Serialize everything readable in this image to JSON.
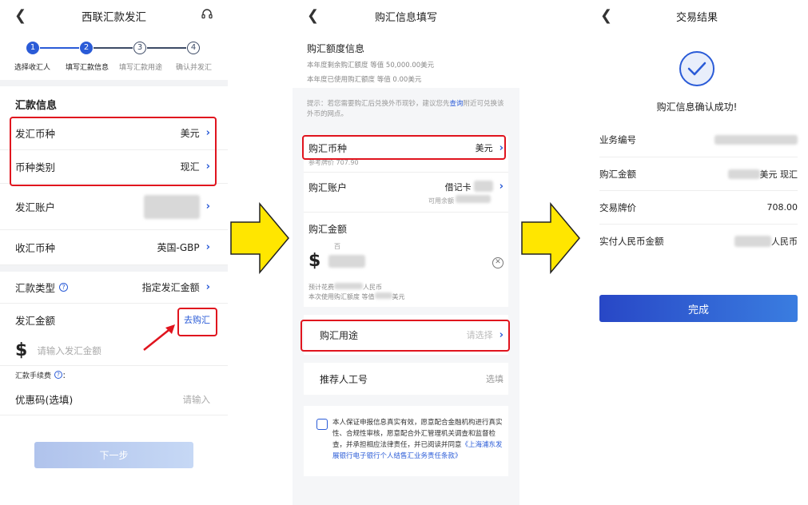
{
  "screen1": {
    "title": "西联汇款发汇",
    "steps": [
      "1",
      "2",
      "3",
      "4"
    ],
    "step_labels": [
      "选择收汇人",
      "填写汇款信息",
      "填写汇款用途",
      "确认并发汇"
    ],
    "section_title": "汇款信息",
    "currency_label": "发汇币种",
    "currency_value": "美元",
    "category_label": "币种类别",
    "category_value": "现汇",
    "account_label": "发汇账户",
    "recv_currency_label": "收汇币种",
    "recv_currency_value": "英国-GBP",
    "type_label": "汇款类型",
    "type_value": "指定发汇金额",
    "amount_label": "发汇金额",
    "go_buy": "去购汇",
    "dollar": "$",
    "amount_placeholder": "请输入发汇金额",
    "fee_label": "汇款手续费",
    "fee_colon": "：",
    "coupon_label": "优惠码(选填)",
    "coupon_placeholder": "请输入",
    "next_button": "下一步"
  },
  "screen2": {
    "title": "购汇信息填写",
    "quota_title": "购汇额度信息",
    "quota_remaining": "本年度剩余购汇额度 等值 50,000.00美元",
    "quota_used": "本年度已使用购汇额度 等值 0.00美元",
    "tip_prefix": "提示：若您需要购汇后兑换外币现钞，建议您先",
    "tip_link": "查询",
    "tip_suffix": "附近可兑换该外币的网点。",
    "currency_label": "购汇币种",
    "currency_value": "美元",
    "ref_price": "参考牌价 707.90",
    "account_label": "购汇账户",
    "account_value": "借记卡",
    "available": "可用余额",
    "amount_title": "购汇金额",
    "hundred": "百",
    "dollar": "$",
    "est_cost_prefix": "预计花费",
    "est_cost_suffix": "人民币",
    "quota_use_prefix": "本次使用购汇额度 等值",
    "quota_use_suffix": "美元",
    "purpose_label": "购汇用途",
    "purpose_placeholder": "请选择",
    "referrer_label": "推荐人工号",
    "referrer_value": "选填",
    "agreement_text": "本人保证申报信息真实有效，愿意配合金融机构进行真实性、合规性审核，愿意配合外汇管理机关调查和监督检查，并承担相应法律责任，并已阅读并同意",
    "agreement_link": "《上海浦东发展银行电子银行个人结售汇业务责任条款》"
  },
  "screen3": {
    "title": "交易结果",
    "success_text": "购汇信息确认成功!",
    "biz_no_label": "业务编号",
    "amount_label": "购汇金额",
    "amount_suffix": "美元 现汇",
    "price_label": "交易牌价",
    "price_value": "708.00",
    "rmb_label": "实付人民币金额",
    "rmb_suffix": "人民币",
    "done_button": "完成"
  },
  "colors": {
    "accent": "#2a5bd7",
    "highlight_red": "#e0141e",
    "arrow_yellow": "#ffe600"
  },
  "icons": [
    "back-arrow-icon",
    "headset-icon",
    "help-icon",
    "clear-icon",
    "checkbox-icon",
    "success-check-icon",
    "chevron-right-icon"
  ]
}
